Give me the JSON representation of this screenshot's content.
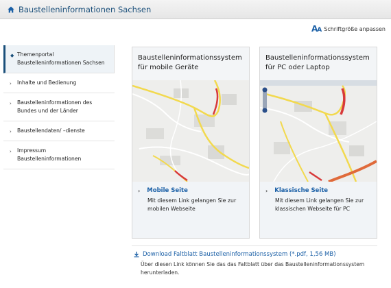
{
  "header": {
    "title": "Baustelleninformationen Sachsen",
    "icon": "home-icon"
  },
  "font_adjust": {
    "label": "Schriftgröße anpassen",
    "icon_text": "AA"
  },
  "sidebar": {
    "items": [
      {
        "label": "Themenportal Baustelleninformationen Sachsen",
        "active": true
      },
      {
        "label": "Inhalte und Bedienung",
        "active": false
      },
      {
        "label": "Baustelleninformationen des Bundes und der Länder",
        "active": false
      },
      {
        "label": "Baustellendaten/ –dienste",
        "active": false
      },
      {
        "label": "Impressum Baustelleninformationen",
        "active": false
      }
    ]
  },
  "cards": [
    {
      "title": "Baustelleninformationssystem für mobile Geräte",
      "link_label": "Mobile Seite",
      "description": "Mit diesem Link gelangen Sie zur mobilen Webseite"
    },
    {
      "title": "Baustelleninformationssystem für PC oder Laptop",
      "link_label": "Klassische Seite",
      "description": "Mit diesem Link gelangen Sie zur klassischen Webseite für PC"
    }
  ],
  "download": {
    "link_label": "Download Faltblatt Baustelleninformationssystem (*.pdf, 1,56 MB)",
    "description": "Über diesen Link können Sie das das Faltblatt über das Baustelleninformationssystem herunterladen."
  },
  "colors": {
    "accent": "#1a5fa6",
    "title": "#1a4f7a",
    "road_major": "#f2d94e",
    "construction": "#d83a3a"
  }
}
